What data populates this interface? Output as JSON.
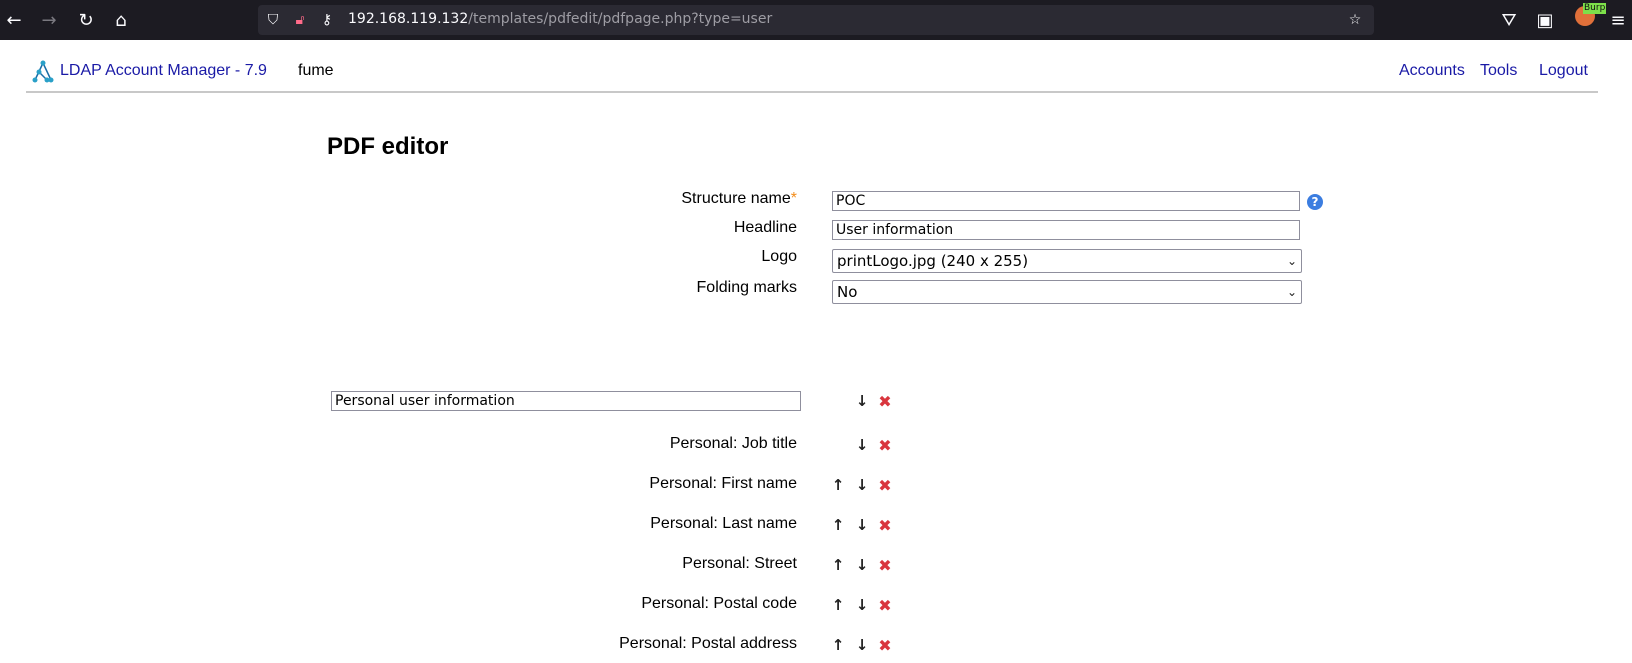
{
  "browser": {
    "url_host": "192.168.119.132",
    "url_path": "/templates/pdfedit/pdfpage.php?type=user",
    "extension_label": "Burp"
  },
  "header": {
    "app_title": "LDAP Account Manager - 7.9",
    "user": "fume",
    "nav": [
      "Accounts",
      "Tools",
      "Logout"
    ]
  },
  "page": {
    "title": "PDF editor",
    "form": {
      "structure_name_label": "Structure name",
      "required_mark": "*",
      "structure_name_value": "POC",
      "headline_label": "Headline",
      "headline_value": "User information",
      "logo_label": "Logo",
      "logo_value": "printLogo.jpg (240 x 255)",
      "folding_marks_label": "Folding marks",
      "folding_marks_value": "No",
      "help_symbol": "?"
    },
    "section": {
      "title_value": "Personal user information",
      "entries": [
        "Personal: Job title",
        "Personal: First name",
        "Personal: Last name",
        "Personal: Street",
        "Personal: Postal code",
        "Personal: Postal address"
      ]
    }
  },
  "colors": {
    "link": "#1a1aa6",
    "required": "#f28c1b",
    "remove": "#d9363e",
    "help": "#3b7de0"
  }
}
